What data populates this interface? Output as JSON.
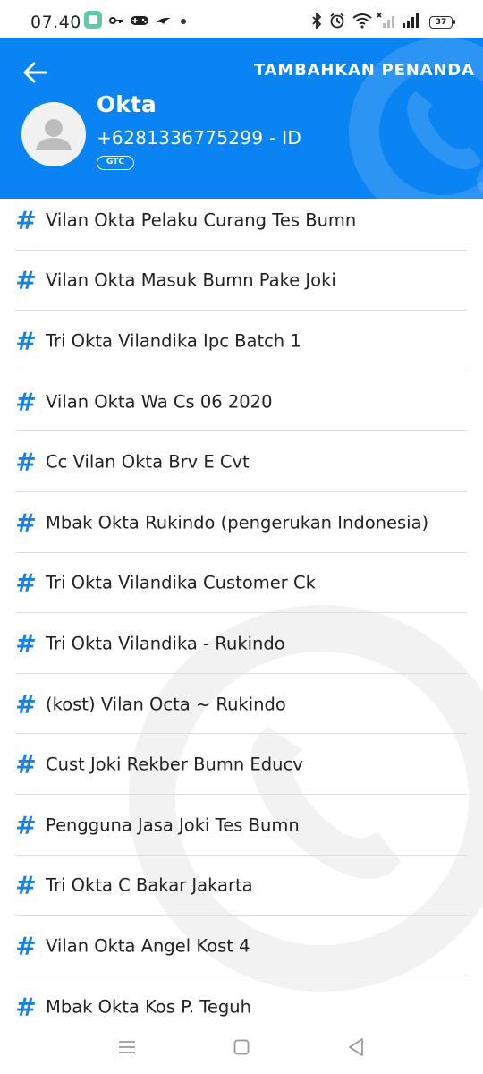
{
  "status_bar": {
    "time": "07.40",
    "battery": "37",
    "icons": [
      "app-icon",
      "key-icon",
      "gamepad-icon",
      "bird-icon",
      "dot-icon",
      "bluetooth-icon",
      "alarm-icon",
      "wifi-icon",
      "no-signal-icon",
      "signal-icon",
      "battery-icon"
    ]
  },
  "header": {
    "action_label": "TAMBAHKAN PENANDA",
    "contact_name": "Okta",
    "contact_number": "+6281336775299 - ID",
    "badge": "GTC",
    "background_color": "#0a84f2",
    "icons": [
      "back-arrow-icon",
      "avatar-icon",
      "phone-watermark-icon"
    ]
  },
  "tags": {
    "icon": "hash-icon",
    "accent_color": "#1a7fe6",
    "items": [
      {
        "label": "Vilan Okta Pelaku Curang Tes Bumn"
      },
      {
        "label": "Vilan Okta Masuk Bumn Pake Joki"
      },
      {
        "label": "Tri Okta Vilandika Ipc Batch 1"
      },
      {
        "label": "Vilan Okta Wa Cs 06 2020"
      },
      {
        "label": "Cc Vilan Okta Brv E Cvt"
      },
      {
        "label": "Mbak Okta Rukindo (pengerukan Indonesia)"
      },
      {
        "label": "Tri Okta Vilandika Customer Ck"
      },
      {
        "label": "Tri Okta Vilandika - Rukindo"
      },
      {
        "label": "(kost) Vilan Octa ~ Rukindo"
      },
      {
        "label": "Cust Joki Rekber Bumn Educv"
      },
      {
        "label": "Pengguna Jasa Joki Tes Bumn"
      },
      {
        "label": "Tri Okta C Bakar Jakarta"
      },
      {
        "label": "Vilan Okta Angel Kost 4"
      },
      {
        "label": "Mbak Okta Kos P. Teguh"
      }
    ]
  },
  "nav_bar": {
    "icons": [
      "menu-icon",
      "home-icon",
      "back-icon"
    ]
  }
}
